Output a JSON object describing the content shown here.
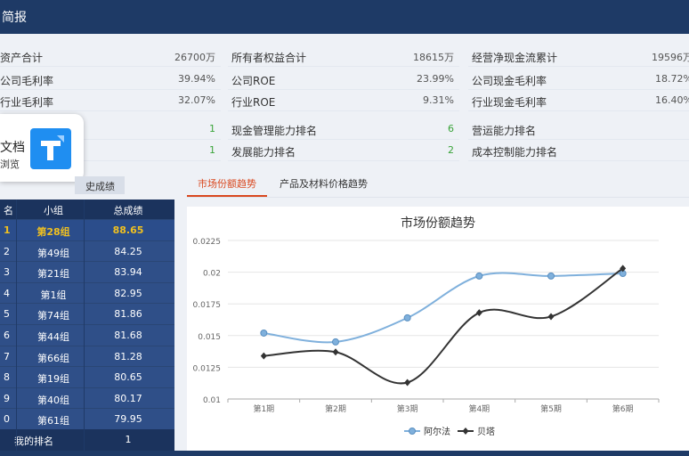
{
  "header": {
    "title": "简报"
  },
  "stats": {
    "row1": [
      {
        "label": "资产合计",
        "value": "26700万"
      },
      {
        "label": "所有者权益合计",
        "value": "18615万"
      },
      {
        "label": "经营净现金流累计",
        "value": "19596万"
      }
    ],
    "row2": [
      {
        "label": "公司毛利率",
        "value": "39.94%"
      },
      {
        "label": "公司ROE",
        "value": "23.99%"
      },
      {
        "label": "公司现金毛利率",
        "value": "18.72%"
      }
    ],
    "row3": [
      {
        "label": "行业毛利率",
        "value": "32.07%"
      },
      {
        "label": "行业ROE",
        "value": "9.31%"
      },
      {
        "label": "行业现金毛利率",
        "value": "16.40%"
      }
    ],
    "row4": [
      {
        "label": "",
        "value": "1"
      },
      {
        "label": "现金管理能力排名",
        "value": "6"
      },
      {
        "label": "营运能力排名",
        "value": ""
      }
    ],
    "row5": [
      {
        "label": "",
        "value": "1"
      },
      {
        "label": "发展能力排名",
        "value": "2"
      },
      {
        "label": "成本控制能力排名",
        "value": ""
      }
    ]
  },
  "doc_popup": {
    "title": "文档",
    "subtitle": "浏览"
  },
  "left_tab": "史成绩",
  "tabs": [
    "市场份额趋势",
    "产品及材料价格趋势"
  ],
  "ranking": {
    "headers": [
      "名",
      "小组",
      "总成绩"
    ],
    "rows": [
      {
        "rank": "1",
        "group": "第28组",
        "score": "88.65"
      },
      {
        "rank": "2",
        "group": "第49组",
        "score": "84.25"
      },
      {
        "rank": "3",
        "group": "第21组",
        "score": "83.94"
      },
      {
        "rank": "4",
        "group": "第1组",
        "score": "82.95"
      },
      {
        "rank": "5",
        "group": "第74组",
        "score": "81.86"
      },
      {
        "rank": "6",
        "group": "第44组",
        "score": "81.68"
      },
      {
        "rank": "7",
        "group": "第66组",
        "score": "81.28"
      },
      {
        "rank": "8",
        "group": "第19组",
        "score": "80.65"
      },
      {
        "rank": "9",
        "group": "第40组",
        "score": "80.17"
      },
      {
        "rank": "0",
        "group": "第61组",
        "score": "79.95"
      }
    ],
    "footer_label": "我的排名",
    "footer_value": "1"
  },
  "chart_data": {
    "type": "line",
    "title": "市场份额趋势",
    "categories": [
      "第1期",
      "第2期",
      "第3期",
      "第4期",
      "第5期",
      "第6期"
    ],
    "ylim": [
      0.01,
      0.0225
    ],
    "yticks": [
      "0.0225",
      "0.02",
      "0.0175",
      "0.015",
      "0.0125",
      "0.01"
    ],
    "series": [
      {
        "name": "阿尔法",
        "values": [
          0.0152,
          0.0145,
          0.0164,
          0.0197,
          0.0197,
          0.0199
        ],
        "color": "#7fb0dc"
      },
      {
        "name": "贝塔",
        "values": [
          0.0134,
          0.0137,
          0.0113,
          0.0168,
          0.0165,
          0.0203
        ],
        "color": "#333333"
      }
    ],
    "legend": "bottom"
  }
}
